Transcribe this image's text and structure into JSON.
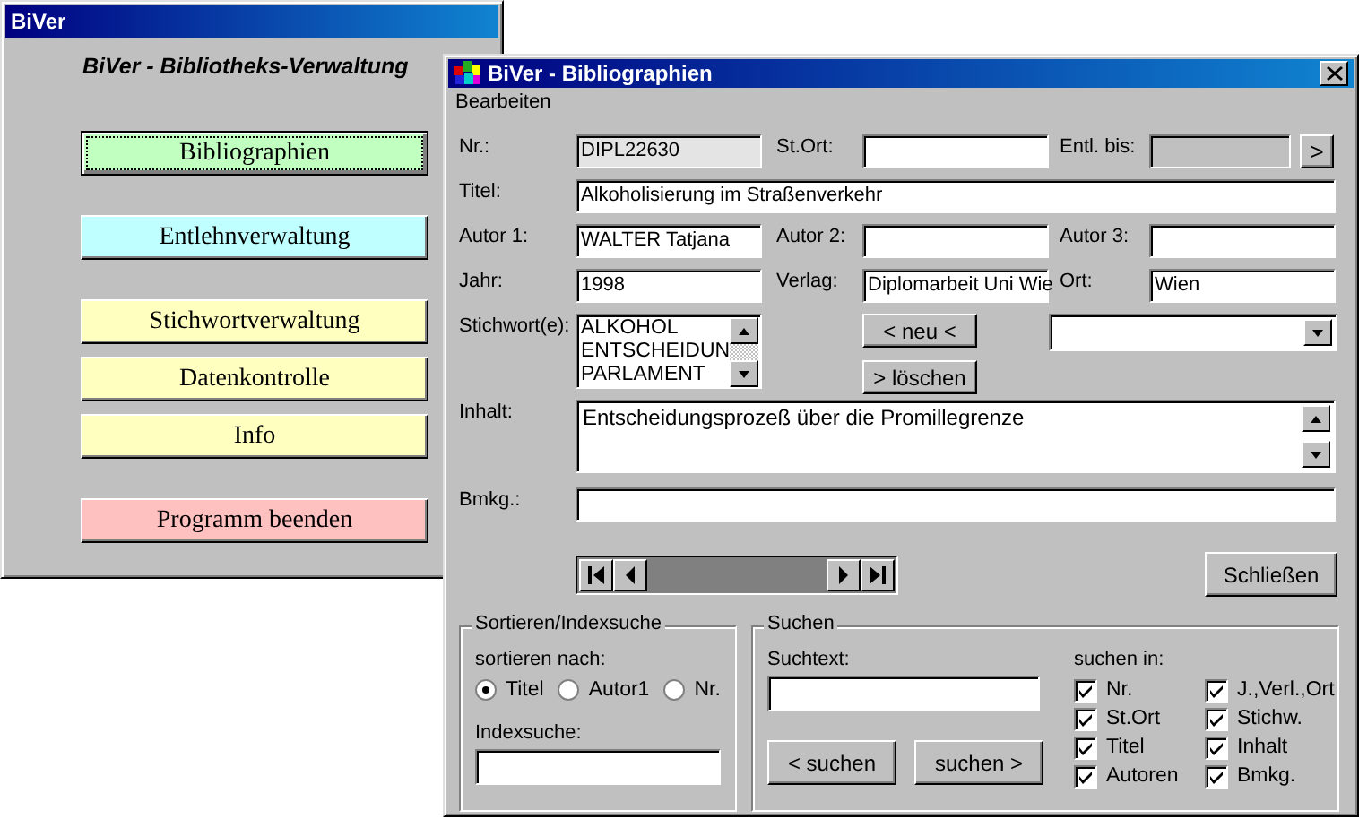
{
  "main_window": {
    "title": "BiVer",
    "heading": "BiVer - Bibliotheks-Verwaltung",
    "button_groups": [
      [
        {
          "label": "Bibliographien",
          "color": "#c0ffc0",
          "focused": true
        }
      ],
      [
        {
          "label": "Entlehnverwaltung",
          "color": "#c0ffff",
          "focused": false
        }
      ],
      [
        {
          "label": "Stichwortverwaltung",
          "color": "#ffffc0",
          "focused": false
        },
        {
          "label": "Datenkontrolle",
          "color": "#ffffc0",
          "focused": false
        },
        {
          "label": "Info",
          "color": "#ffffc0",
          "focused": false
        }
      ],
      [
        {
          "label": "Programm beenden",
          "color": "#ffc0c0",
          "focused": false
        }
      ]
    ]
  },
  "dialog": {
    "title": "BiVer - Bibliographien",
    "menu": [
      "Bearbeiten"
    ],
    "rows": [
      [
        {
          "label": "Nr.:",
          "value": "DIPL22630",
          "readonly": true,
          "disabled": false
        },
        {
          "label": "St.Ort:",
          "readonly": false,
          "disabled": false
        },
        {
          "label": "Entl. bis:",
          "readonly": false,
          "disabled": true,
          "button": ">"
        }
      ],
      [
        {
          "label": "Titel:",
          "value": "Alkoholisierung im Straßenverkehr",
          "readonly": false,
          "disabled": false
        }
      ],
      [
        {
          "label": "Autor 1:",
          "value": "WALTER Tatjana",
          "readonly": false,
          "disabled": false
        },
        {
          "label": "Autor 2:",
          "readonly": false,
          "disabled": false
        },
        {
          "label": "Autor 3:",
          "readonly": false,
          "disabled": false
        }
      ],
      [
        {
          "label": "Jahr:",
          "value": "1998",
          "readonly": false,
          "disabled": false
        },
        {
          "label": "Verlag:",
          "value": "Diplomarbeit Uni Wie",
          "readonly": false,
          "disabled": false
        },
        {
          "label": "Ort:",
          "value": "Wien",
          "readonly": false,
          "disabled": false
        }
      ]
    ],
    "keywords": {
      "label": "Stichwort(e):",
      "items": [
        "ALKOHOL",
        "ENTSCHEIDUN",
        "PARLAMENT"
      ],
      "buttons": [
        "< neu <",
        "> löschen"
      ]
    },
    "content": {
      "label": "Inhalt:",
      "value": "Entscheidungsprozeß über die Promillegrenze"
    },
    "remark": {
      "label": "Bmkg.:"
    },
    "close_button": "Schließen",
    "sort_group": {
      "title": "Sortieren/Indexsuche",
      "sort_label": "sortieren nach:",
      "options": [
        {
          "label": "Titel",
          "selected": true
        },
        {
          "label": "Autor1",
          "selected": false
        },
        {
          "label": "Nr.",
          "selected": false
        }
      ],
      "index_label": "Indexsuche:"
    },
    "search_group": {
      "title": "Suchen",
      "text_label": "Suchtext:",
      "buttons": [
        "< suchen",
        "suchen >"
      ],
      "in_label": "suchen in:",
      "options": [
        {
          "label": "Nr.",
          "checked": true
        },
        {
          "label": "St.Ort",
          "checked": true
        },
        {
          "label": "Titel",
          "checked": true
        },
        {
          "label": "Autoren",
          "checked": true
        },
        {
          "label": "J.,Verl.,Ort",
          "checked": true
        },
        {
          "label": "Stichw.",
          "checked": true
        },
        {
          "label": "Inhalt",
          "checked": true
        },
        {
          "label": "Bmkg.",
          "checked": true
        }
      ]
    }
  }
}
